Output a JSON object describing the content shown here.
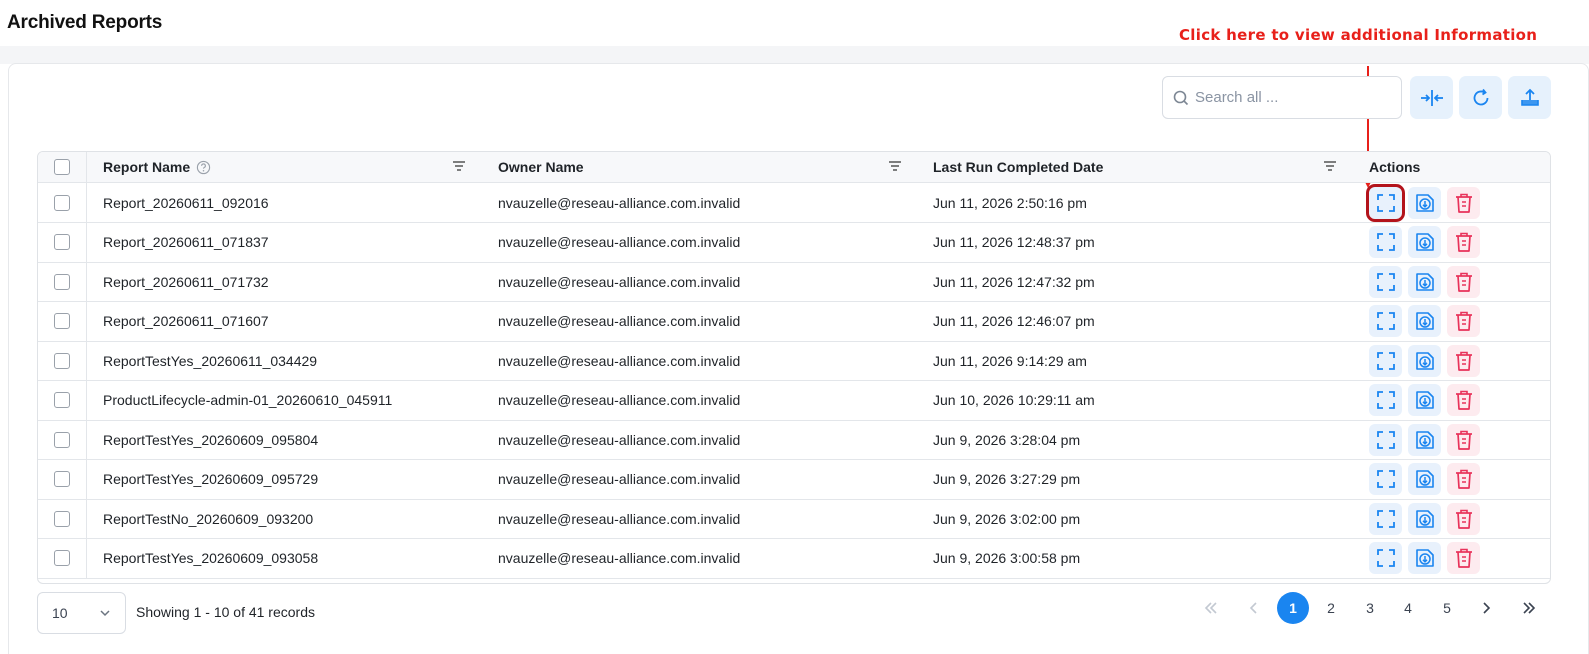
{
  "page": {
    "title": "Archived Reports"
  },
  "annotation": {
    "text": "Click here to view additional Information",
    "color": "#e8201a"
  },
  "toolbar": {
    "search_placeholder": "Search all ...",
    "buttons": [
      {
        "icon": "collapse-columns-icon"
      },
      {
        "icon": "refresh-icon"
      },
      {
        "icon": "export-upload-icon"
      }
    ]
  },
  "table": {
    "columns": [
      {
        "label": "Report Name",
        "has_help_icon": true,
        "has_filter": true
      },
      {
        "label": "Owner Name",
        "has_filter": true
      },
      {
        "label": "Last Run Completed Date",
        "has_filter": true
      },
      {
        "label": "Actions"
      }
    ],
    "rows": [
      {
        "name": "Report_20260611_092016",
        "owner": "nvauzelle@reseau-alliance.com.invalid",
        "date": "Jun 11, 2026 2:50:16 pm"
      },
      {
        "name": "Report_20260611_071837",
        "owner": "nvauzelle@reseau-alliance.com.invalid",
        "date": "Jun 11, 2026 12:48:37 pm"
      },
      {
        "name": "Report_20260611_071732",
        "owner": "nvauzelle@reseau-alliance.com.invalid",
        "date": "Jun 11, 2026 12:47:32 pm"
      },
      {
        "name": "Report_20260611_071607",
        "owner": "nvauzelle@reseau-alliance.com.invalid",
        "date": "Jun 11, 2026 12:46:07 pm"
      },
      {
        "name": "ReportTestYes_20260611_034429",
        "owner": "nvauzelle@reseau-alliance.com.invalid",
        "date": "Jun 11, 2026 9:14:29 am"
      },
      {
        "name": "ProductLifecycle-admin-01_20260610_045911",
        "owner": "nvauzelle@reseau-alliance.com.invalid",
        "date": "Jun 10, 2026 10:29:11 am"
      },
      {
        "name": "ReportTestYes_20260609_095804",
        "owner": "nvauzelle@reseau-alliance.com.invalid",
        "date": "Jun 9, 2026 3:28:04 pm"
      },
      {
        "name": "ReportTestYes_20260609_095729",
        "owner": "nvauzelle@reseau-alliance.com.invalid",
        "date": "Jun 9, 2026 3:27:29 pm"
      },
      {
        "name": "ReportTestNo_20260609_093200",
        "owner": "nvauzelle@reseau-alliance.com.invalid",
        "date": "Jun 9, 2026 3:02:00 pm"
      },
      {
        "name": "ReportTestYes_20260609_093058",
        "owner": "nvauzelle@reseau-alliance.com.invalid",
        "date": "Jun 9, 2026 3:00:58 pm"
      }
    ],
    "row_actions": [
      "expand-icon",
      "download-icon",
      "delete-icon"
    ]
  },
  "pagination": {
    "page_size": "10",
    "summary": "Showing 1 - 10 of 41 records",
    "pages": [
      "1",
      "2",
      "3",
      "4",
      "5"
    ],
    "current_page": "1"
  },
  "colors": {
    "accent": "#1a85f0",
    "action_bg": "#e8f1fc",
    "delete": "#e8325a",
    "highlight_box": "#b3131b"
  }
}
